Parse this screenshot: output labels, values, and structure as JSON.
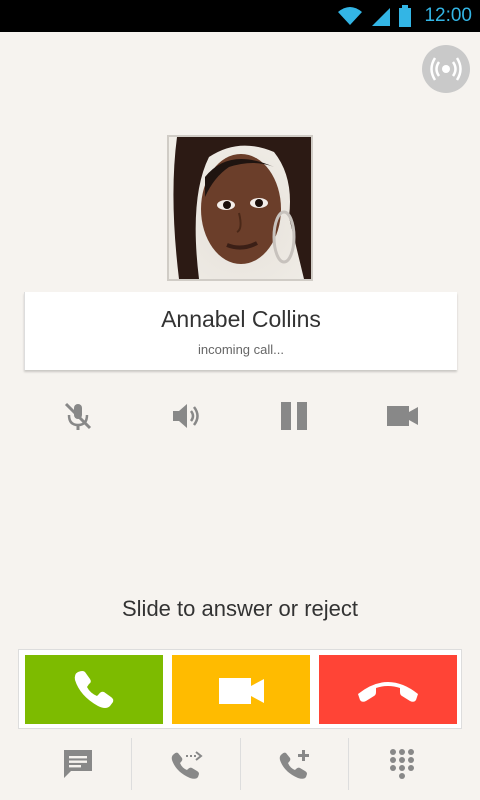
{
  "status_bar": {
    "time": "12:00"
  },
  "caller": {
    "name": "Annabel Collins",
    "status": "incoming call..."
  },
  "hint": "Slide to answer or reject",
  "colors": {
    "accept": "#7dbb00",
    "video": "#ffbb00",
    "reject": "#ff4436",
    "status_accent": "#33b5e5"
  },
  "icons": {
    "top": [
      "signal-icon"
    ],
    "controls": [
      "mute-icon",
      "speaker-icon",
      "pause-icon",
      "video-camera-icon"
    ],
    "actions": [
      "phone-icon",
      "video-camera-icon",
      "hang-up-icon"
    ],
    "bottom": [
      "message-icon",
      "call-forward-icon",
      "add-call-icon",
      "dialpad-icon"
    ]
  }
}
